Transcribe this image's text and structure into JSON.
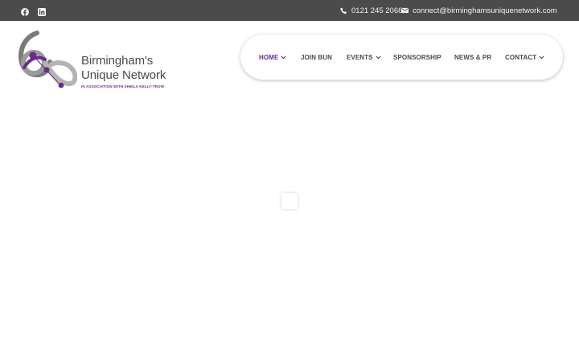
{
  "topbar": {
    "social": [
      {
        "icon": "facebook-icon"
      },
      {
        "icon": "linkedin-icon"
      }
    ],
    "phone": "0121 245 2066",
    "email": "connect@birminghamsuniquenetwork.com"
  },
  "logo": {
    "line1": "Birmingham's",
    "line2": "Unique Network",
    "tagline": "IN ASSOCIATION WITH SHEILA KELLY-TROW"
  },
  "nav": {
    "items": [
      {
        "label": "HOME",
        "active": true,
        "dropdown": true
      },
      {
        "label": "JOIN BUN",
        "active": false,
        "dropdown": false
      },
      {
        "label": "EVENTS",
        "active": false,
        "dropdown": true
      },
      {
        "label": "SPONSORSHIP",
        "active": false,
        "dropdown": false
      },
      {
        "label": "NEWS & PR",
        "active": false,
        "dropdown": false
      },
      {
        "label": "CONTACT",
        "active": false,
        "dropdown": true
      }
    ]
  },
  "colors": {
    "topbar_bg": "#4b4b4b",
    "accent_purple": "#6a2c8c",
    "nav_text": "#4a4a4a"
  }
}
